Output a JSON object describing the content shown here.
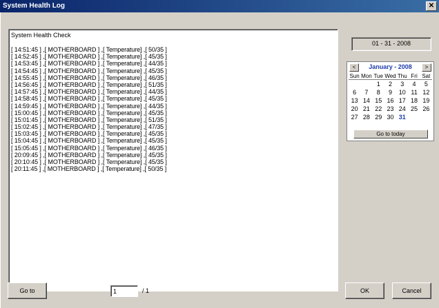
{
  "window": {
    "title": "System Health Log",
    "close_glyph": "✕"
  },
  "log": {
    "heading": "System Health Check",
    "lines": [
      "[ 14:51:45 ] ,[ MOTHERBOARD ] ,[ Temperature] ,[ 50/35 ]",
      "[ 14:52:45 ] ,[ MOTHERBOARD ] ,[ Temperature] ,[ 45/35 ]",
      "[ 14:53:45 ] ,[ MOTHERBOARD ] ,[ Temperature] ,[ 44/35 ]",
      "[ 14:54:45 ] ,[ MOTHERBOARD ] ,[ Temperature] ,[ 45/35 ]",
      "[ 14:55:45 ] ,[ MOTHERBOARD ] ,[ Temperature] ,[ 46/35 ]",
      "[ 14:56:45 ] ,[ MOTHERBOARD ] ,[ Temperature] ,[ 51/35 ]",
      "[ 14:57:45 ] ,[ MOTHERBOARD ] ,[ Temperature] ,[ 44/35 ]",
      "[ 14:58:45 ] ,[ MOTHERBOARD ] ,[ Temperature] ,[ 45/35 ]",
      "[ 14:59:45 ] ,[ MOTHERBOARD ] ,[ Temperature] ,[ 44/35 ]",
      "[ 15:00:45 ] ,[ MOTHERBOARD ] ,[ Temperature] ,[ 45/35 ]",
      "[ 15:01:45 ] ,[ MOTHERBOARD ] ,[ Temperature] ,[ 51/35 ]",
      "[ 15:02:45 ] ,[ MOTHERBOARD ] ,[ Temperature] ,[ 47/35 ]",
      "[ 15:03:45 ] ,[ MOTHERBOARD ] ,[ Temperature] ,[ 45/35 ]",
      "[ 15:04:45 ] ,[ MOTHERBOARD ] ,[ Temperature] ,[ 45/35 ]",
      "[ 15:05:45 ] ,[ MOTHERBOARD ] ,[ Temperature] ,[ 46/35 ]",
      "[ 20:09:45 ] ,[ MOTHERBOARD ] ,[ Temperature] ,[ 45/35 ]",
      "[ 20:10:45 ] ,[ MOTHERBOARD ] ,[ Temperature] ,[ 45/35 ]",
      "[ 20:11:45 ] ,[ MOTHERBOARD ] ,[ Temperature] ,[ 50/35 ]"
    ]
  },
  "date_display": "01 - 31 - 2008",
  "calendar": {
    "month_label": "January - 2008",
    "prev_glyph": "<",
    "next_glyph": ">",
    "weekdays": [
      "Sun",
      "Mon",
      "Tue",
      "Wed",
      "Thu",
      "Fri",
      "Sat"
    ],
    "days": [
      "",
      "",
      "1",
      "2",
      "3",
      "4",
      "5",
      "6",
      "7",
      "8",
      "9",
      "10",
      "11",
      "12",
      "13",
      "14",
      "15",
      "16",
      "17",
      "18",
      "19",
      "20",
      "21",
      "22",
      "23",
      "24",
      "25",
      "26",
      "27",
      "28",
      "29",
      "30",
      "31",
      "",
      ""
    ],
    "today": "31",
    "go_today_label": "Go to today"
  },
  "footer": {
    "goto_label": "Go to",
    "page_value": "1",
    "page_separator": "/  1",
    "ok_label": "OK",
    "cancel_label": "Cancel"
  },
  "colors": {
    "title_bar": "#0a246a",
    "calendar_accent": "#1e3ea8",
    "face": "#d4d0c8"
  }
}
